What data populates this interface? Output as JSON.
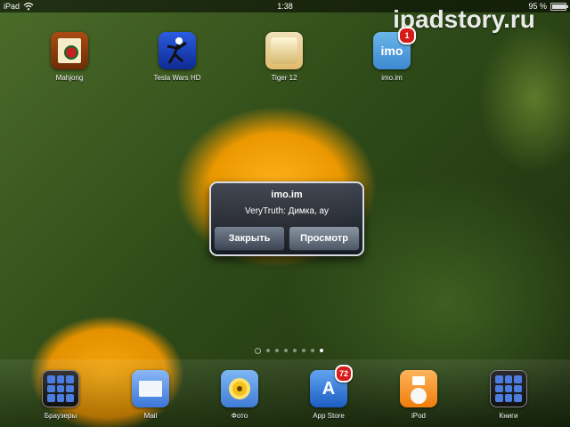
{
  "status": {
    "device": "iPad",
    "time": "1:38",
    "battery_percent_text": "95 %",
    "battery_level": 0.95
  },
  "watermark": "ipadstory.ru",
  "home_apps": [
    {
      "label": "Mahjong",
      "icon": "mahjong-tile-icon"
    },
    {
      "label": "Tesla Wars HD",
      "icon": "stickman-icon"
    },
    {
      "label": "Tiger 12",
      "icon": "golf-game-icon"
    },
    {
      "label": "imo.im",
      "icon": "imo-icon",
      "badge": "1"
    }
  ],
  "alert": {
    "title": "imo.im",
    "message": "VeryTruth: Димка, ау",
    "close_label": "Закрыть",
    "view_label": "Просмотр"
  },
  "page_indicator": {
    "pages": 7,
    "current": 7
  },
  "dock": [
    {
      "label": "Браузеры",
      "icon": "folder-icon"
    },
    {
      "label": "Mail",
      "icon": "mail-icon"
    },
    {
      "label": "Фото",
      "icon": "photos-icon"
    },
    {
      "label": "App Store",
      "icon": "app-store-icon",
      "badge": "72"
    },
    {
      "label": "iPod",
      "icon": "ipod-icon"
    },
    {
      "label": "Книги",
      "icon": "folder-icon"
    }
  ],
  "colors": {
    "badge": "#d71b1b",
    "wallpaper_flower": "#f0a000",
    "alert_bg": "#2b3242"
  }
}
